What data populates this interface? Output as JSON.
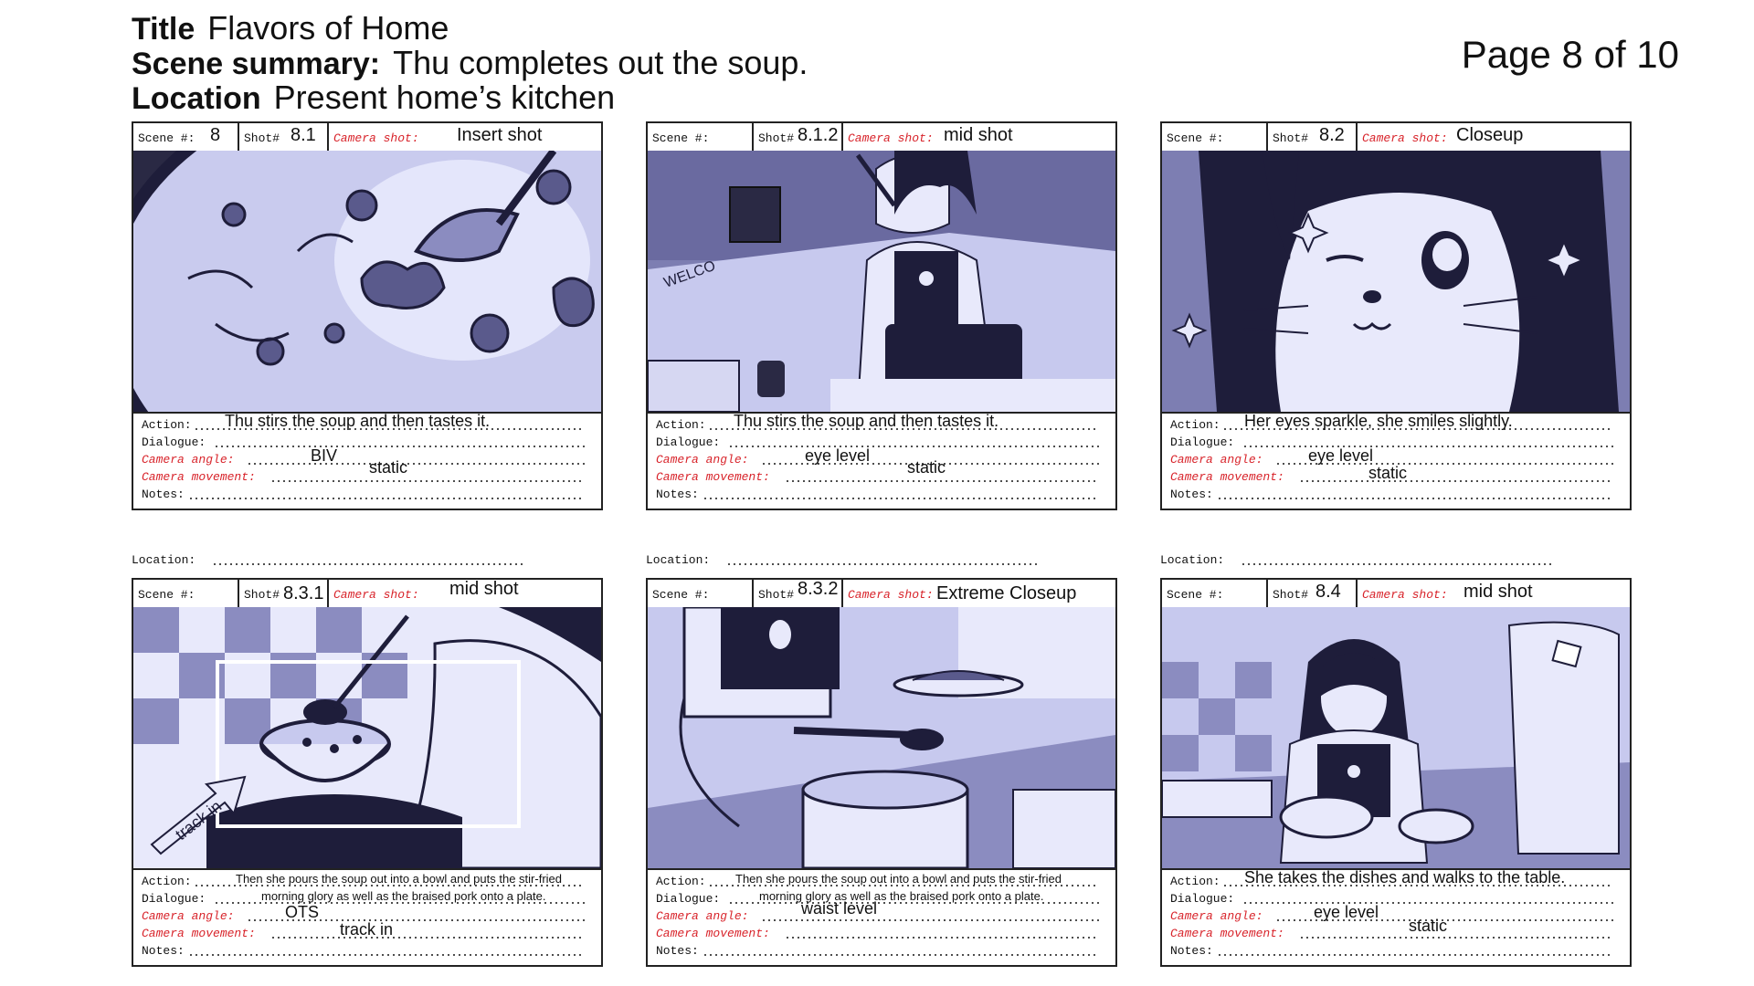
{
  "header": {
    "title_key": "Title",
    "title": "Flavors of Home",
    "summary_key": "Scene summary:",
    "summary": "Thu completes out the soup.",
    "location_key": "Location",
    "location": "Present home’s kitchen",
    "page": "Page 8 of 10"
  },
  "labels": {
    "scene": "Scene #:",
    "shot": "Shot#",
    "camera_shot": "Camera shot:",
    "action": "Action:",
    "dialogue": "Dialogue:",
    "camera_angle": "Camera angle:",
    "camera_movement": "Camera movement:",
    "notes": "Notes:",
    "location": "Location:"
  },
  "colors": {
    "red_label": "#d8232a",
    "art_purple": "#c7c9ea",
    "art_dark": "#1e1d3a"
  },
  "panels": [
    {
      "scene": "8",
      "shot": "8.1",
      "camera_shot": "Insert shot",
      "action": "Thu stirs the soup and then tastes it.",
      "dialogue": "",
      "camera_angle": "BIV",
      "camera_movement": "static",
      "notes": ""
    },
    {
      "scene": "",
      "shot": "8.1.2",
      "camera_shot": "mid shot",
      "action": "Thu stirs the soup and then tastes it.",
      "dialogue": "",
      "camera_angle": "eye level",
      "camera_movement": "static",
      "notes": ""
    },
    {
      "scene": "",
      "shot": "8.2",
      "camera_shot": "Closeup",
      "action": "Her eyes sparkle, she smiles slightly.",
      "dialogue": "",
      "camera_angle": "eye level",
      "camera_movement": "static",
      "notes": ""
    },
    {
      "scene": "",
      "shot": "8.3.1",
      "camera_shot": "mid shot",
      "action": "Then she pours the soup out into a bowl and puts the stir-fried",
      "dialogue": "morning glory as well as the braised pork onto a plate.",
      "camera_angle": "OTS",
      "camera_movement": "track in",
      "notes": "",
      "art_note": "track in"
    },
    {
      "scene": "",
      "shot": "8.3.2",
      "camera_shot": "Extreme Closeup",
      "action": "Then she pours the soup out into a bowl and puts the stir-fried",
      "dialogue": "morning glory as well as the braised pork onto a plate.",
      "camera_angle": "waist level",
      "camera_movement": "",
      "notes": ""
    },
    {
      "scene": "",
      "shot": "8.4",
      "camera_shot": "mid shot",
      "action": "She takes the dishes and walks to the table.",
      "dialogue": "",
      "camera_angle": "eye level",
      "camera_movement": "static",
      "notes": ""
    }
  ]
}
